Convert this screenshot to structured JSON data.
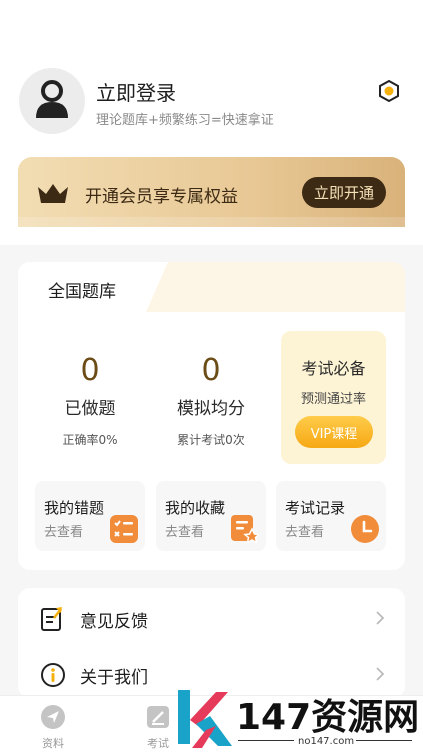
{
  "profile": {
    "login_title": "立即登录",
    "login_subtitle": "理论题库+频繁练习=快速拿证",
    "settings_icon": "hexagon-settings-icon"
  },
  "vip_banner": {
    "text": "开通会员享专属权益",
    "button": "立即开通",
    "icon": "crown-icon"
  },
  "question_bank": {
    "tab_title": "全国题库",
    "stats": [
      {
        "value": "0",
        "label": "已做题",
        "sub": "正确率0%"
      },
      {
        "value": "0",
        "label": "模拟均分",
        "sub": "累计考试0次"
      }
    ],
    "exam_box": {
      "title": "考试必备",
      "subtitle": "预测通过率",
      "button": "VIP课程"
    },
    "tiles": [
      {
        "title": "我的错题",
        "sub": "去查看",
        "icon": "wrong-list-icon"
      },
      {
        "title": "我的收藏",
        "sub": "去查看",
        "icon": "favorite-doc-icon"
      },
      {
        "title": "考试记录",
        "sub": "去查看",
        "icon": "clock-icon"
      }
    ]
  },
  "menu": [
    {
      "label": "意见反馈",
      "icon": "feedback-icon"
    },
    {
      "label": "关于我们",
      "icon": "info-icon"
    }
  ],
  "bottom_nav": [
    {
      "label": "资料",
      "icon": "compass-icon"
    },
    {
      "label": "考试",
      "icon": "exam-icon"
    }
  ],
  "watermark": {
    "text": "147资源网",
    "url": "no147.com"
  },
  "colors": {
    "accent_brown": "#3d2a14",
    "gold_number": "#6b4b16",
    "vip_orange": "#f6a814",
    "tile_orange": "#f08c3a"
  }
}
